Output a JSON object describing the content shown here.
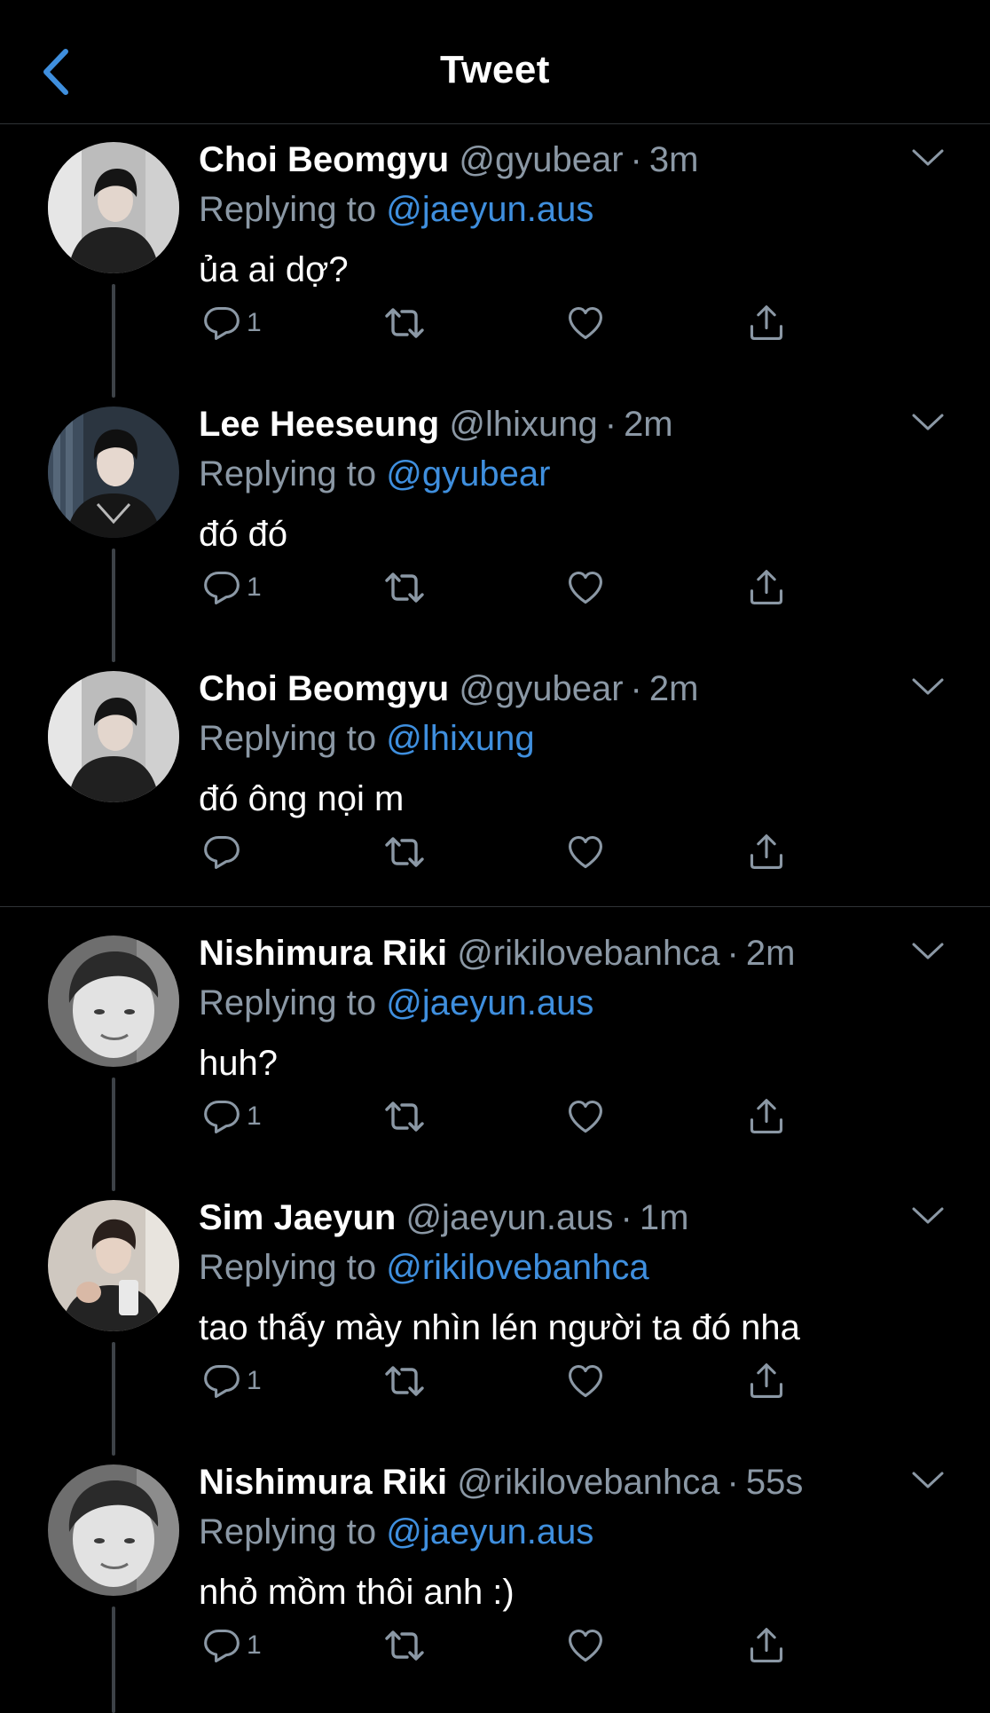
{
  "header": {
    "title": "Tweet",
    "back_icon": "chevron-left-icon"
  },
  "colors": {
    "background": "#000000",
    "link": "#3f8fde",
    "muted": "#8b98a5",
    "divider": "#2f3336"
  },
  "tweets": [
    {
      "name": "Choi Beomgyu",
      "handle": "@gyubear",
      "dot": "·",
      "time": "3m",
      "reply_prefix": "Replying to",
      "reply_to": "@jaeyun.aus",
      "text": "ủa ai dợ?",
      "reply_count": "1",
      "avatar": "choi-beomgyu-avatar"
    },
    {
      "name": "Lee Heeseung",
      "handle": "@lhixung",
      "dot": "·",
      "time": "2m",
      "reply_prefix": "Replying to",
      "reply_to": "@gyubear",
      "text": "đó đó",
      "reply_count": "1",
      "avatar": "lee-heeseung-avatar"
    },
    {
      "name": "Choi Beomgyu",
      "handle": "@gyubear",
      "dot": "·",
      "time": "2m",
      "reply_prefix": "Replying to",
      "reply_to": "@lhixung",
      "text": "đó ông nọi m",
      "reply_count": "",
      "avatar": "choi-beomgyu-avatar"
    },
    {
      "name": "Nishimura Riki",
      "handle": "@rikilovebanhca",
      "dot": "·",
      "time": "2m",
      "reply_prefix": "Replying to",
      "reply_to": "@jaeyun.aus",
      "text": "huh?",
      "reply_count": "1",
      "avatar": "nishimura-riki-avatar"
    },
    {
      "name": "Sim Jaeyun",
      "handle": "@jaeyun.aus",
      "dot": "·",
      "time": "1m",
      "reply_prefix": "Replying to",
      "reply_to": "@rikilovebanhca",
      "text": "tao thấy mày nhìn lén người ta đó nha",
      "reply_count": "1",
      "avatar": "sim-jaeyun-avatar"
    },
    {
      "name": "Nishimura Riki",
      "handle": "@rikilovebanhca",
      "dot": "·",
      "time": "55s",
      "reply_prefix": "Replying to",
      "reply_to": "@jaeyun.aus",
      "text": "nhỏ mồm thôi anh :)",
      "reply_count": "1",
      "avatar": "nishimura-riki-avatar"
    }
  ],
  "action_icons": [
    "reply-icon",
    "retweet-icon",
    "like-icon",
    "share-icon"
  ]
}
